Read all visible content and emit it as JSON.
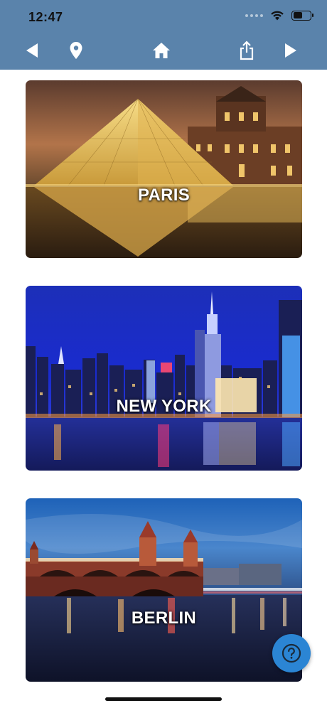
{
  "status_bar": {
    "time": "12:47"
  },
  "toolbar": {
    "icons": [
      "back-arrow-icon",
      "location-pin-icon",
      "home-icon",
      "share-icon",
      "forward-arrow-icon"
    ],
    "color": "#5a83ab",
    "icon_color": "#ffffff"
  },
  "cities": [
    {
      "label": "PARIS"
    },
    {
      "label": "NEW YORK"
    },
    {
      "label": "BERLIN"
    }
  ],
  "help_button": {
    "icon": "question-mark-icon",
    "color": "#2b85d4"
  }
}
